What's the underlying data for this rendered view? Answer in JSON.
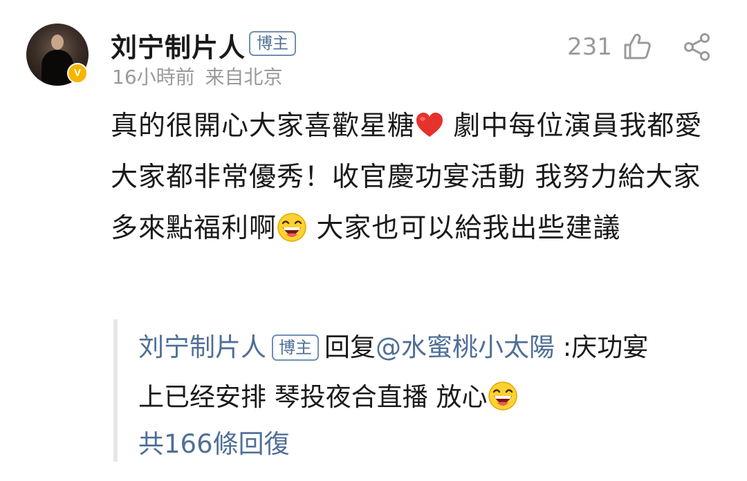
{
  "post": {
    "author": "刘宁制片人",
    "author_tag": "博主",
    "time": "16小時前",
    "location": "来自北京",
    "like_count": "231",
    "avatar_badge": "V",
    "text_part1": "真的很開心大家喜歡星糖",
    "text_part2": "劇中每位演員我都愛 大家都非常優秀！收官慶功宴活動 我努力給大家多來點福利啊",
    "text_part3": "大家也可以給我出些建議"
  },
  "reply": {
    "author": "刘宁制片人",
    "author_tag": "博主",
    "action": "回复",
    "mention": "@水蜜桃小太陽",
    "text_line1": " :庆功宴",
    "text_line2": "上已经安排 琴投夜合直播 放心",
    "count": "共166條回復"
  },
  "icons": {
    "like": "thumbs-up-icon",
    "share": "share-icon",
    "heart": "red-heart-emoji",
    "laugh": "laughing-emoji"
  },
  "colors": {
    "link_blue": "#4f6f96",
    "badge_gold": "#f7b500",
    "meta_gray": "#9a9a9a",
    "heart_red": "#e5322d"
  }
}
